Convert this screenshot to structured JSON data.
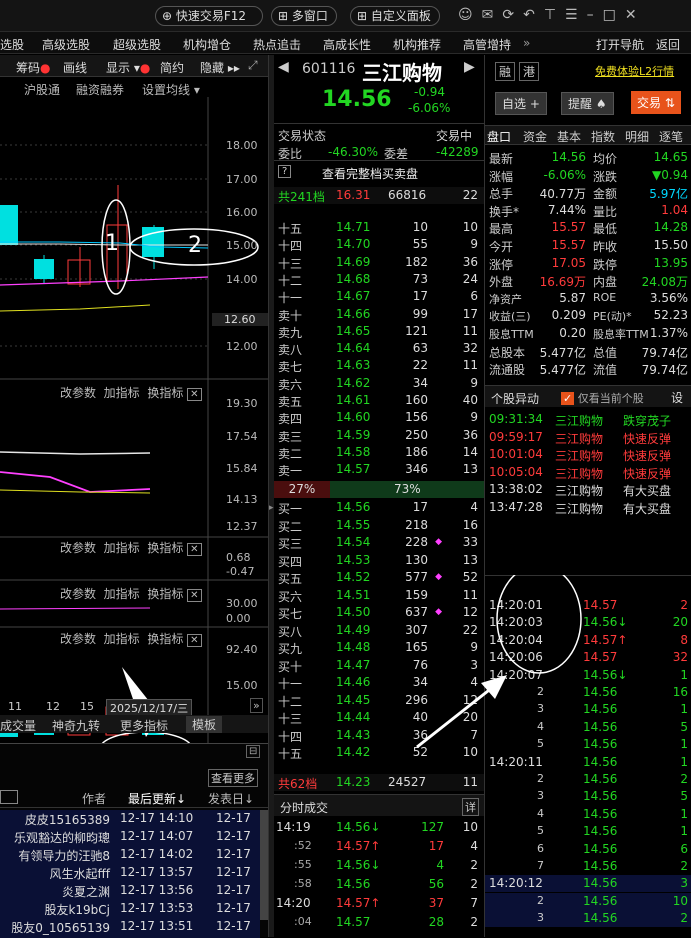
{
  "top": {
    "buttons": [
      "快速交易F12",
      "多窗口",
      "自定义面板"
    ]
  },
  "menu": [
    "选股",
    "高级选股",
    "超级选股",
    "机构增仓",
    "热点追击",
    "高成长性",
    "机构推荐",
    "高管增持",
    "»",
    "打开导航",
    "返回"
  ],
  "toolbar": [
    "筹码",
    "画线",
    "显示",
    "简约",
    "隐藏"
  ],
  "chart": {
    "tabs": [
      "沪股通",
      "融资融券",
      "设置均线"
    ],
    "yticks": [
      "18.00",
      "17.00",
      "16.00",
      "15.00",
      "14.00",
      "12.60",
      "12.00"
    ],
    "sub1": {
      "ops": [
        "改参数",
        "加指标",
        "换指标"
      ],
      "ticks": [
        "19.30",
        "17.54",
        "15.84",
        "14.13",
        "12.37"
      ]
    },
    "sub2": {
      "ops": [
        "改参数",
        "加指标",
        "换指标"
      ],
      "ticks": [
        "0.68",
        "-0.47"
      ]
    },
    "sub3": {
      "ops": [
        "改参数",
        "加指标",
        "换指标"
      ],
      "ticks": [
        "30.00",
        "0.00"
      ]
    },
    "sub4": {
      "ops": [
        "改参数",
        "加指标",
        "换指标"
      ],
      "ticks": [
        "92.40",
        "15.00"
      ]
    },
    "xlabels": [
      "11",
      "12",
      "15"
    ],
    "date": "2025/12/17/三",
    "tabs2": [
      "成交量",
      "神奇九转",
      "更多指标",
      "模板"
    ],
    "anno1": "1",
    "anno2": "2"
  },
  "news": {
    "btn": "查看更多",
    "cols": [
      "作者",
      "最后更新↓",
      "发表日↓"
    ],
    "rows": [
      [
        "皮皮15165389",
        "12-17 14:10",
        "12-17"
      ],
      [
        "乐观豁达的柳昀璁",
        "12-17 14:07",
        "12-17"
      ],
      [
        "有领导力的汪驰8",
        "12-17 14:02",
        "12-17"
      ],
      [
        "风生水起fff",
        "12-17 13:57",
        "12-17"
      ],
      [
        "炎夏之渊",
        "12-17 13:56",
        "12-17"
      ],
      [
        "股友k19bCj",
        "12-17 13:53",
        "12-17"
      ],
      [
        "股友0_10565139",
        "12-17 13:51",
        "12-17"
      ]
    ]
  },
  "stock": {
    "code": "601116",
    "name": "三江购物",
    "price": "14.56",
    "chg": "-0.94",
    "pct": "-6.06%",
    "tags": [
      "融",
      "港"
    ],
    "promo": "免费体验L2行情",
    "buttons": [
      "自选 +",
      "提醒",
      "交易"
    ]
  },
  "ob": {
    "status_label": "交易状态",
    "status": "交易中",
    "wb_label": "委比",
    "wb": "-46.30%",
    "wc_label": "委差",
    "wc": "-42289",
    "link": "查看完整档买卖盘",
    "sell_head": [
      "共241档",
      "16.31",
      "66816",
      "22"
    ],
    "sells": [
      [
        "十五",
        "14.71",
        "10",
        "10"
      ],
      [
        "十四",
        "14.70",
        "55",
        "9"
      ],
      [
        "十三",
        "14.69",
        "182",
        "36"
      ],
      [
        "十二",
        "14.68",
        "73",
        "24"
      ],
      [
        "十一",
        "14.67",
        "17",
        "6"
      ],
      [
        "卖十",
        "14.66",
        "99",
        "17"
      ],
      [
        "卖九",
        "14.65",
        "121",
        "11"
      ],
      [
        "卖八",
        "14.64",
        "63",
        "32"
      ],
      [
        "卖七",
        "14.63",
        "22",
        "11"
      ],
      [
        "卖六",
        "14.62",
        "34",
        "9"
      ],
      [
        "卖五",
        "14.61",
        "160",
        "40"
      ],
      [
        "卖四",
        "14.60",
        "156",
        "9"
      ],
      [
        "卖三",
        "14.59",
        "250",
        "36"
      ],
      [
        "卖二",
        "14.58",
        "186",
        "14"
      ],
      [
        "卖一",
        "14.57",
        "346",
        "13"
      ]
    ],
    "ratio": [
      "27%",
      "73%"
    ],
    "buys": [
      [
        "买一",
        "14.56",
        "17",
        "4"
      ],
      [
        "买二",
        "14.55",
        "218",
        "16"
      ],
      [
        "买三",
        "14.54",
        "228",
        "33"
      ],
      [
        "买四",
        "14.53",
        "130",
        "13"
      ],
      [
        "买五",
        "14.52",
        "577",
        "52"
      ],
      [
        "买六",
        "14.51",
        "159",
        "11"
      ],
      [
        "买七",
        "14.50",
        "637",
        "12"
      ],
      [
        "买八",
        "14.49",
        "307",
        "22"
      ],
      [
        "买九",
        "14.48",
        "165",
        "9"
      ],
      [
        "买十",
        "14.47",
        "76",
        "3"
      ],
      [
        "十一",
        "14.46",
        "34",
        "4"
      ],
      [
        "十二",
        "14.45",
        "296",
        "12"
      ],
      [
        "十三",
        "14.44",
        "40",
        "20"
      ],
      [
        "十四",
        "14.43",
        "36",
        "7"
      ],
      [
        "十五",
        "14.42",
        "52",
        "10"
      ]
    ],
    "buy_foot": [
      "共62档",
      "14.23",
      "24527",
      "11"
    ]
  },
  "ticks": {
    "title": "分时成交",
    "btn": "详",
    "rows": [
      [
        "14:19",
        "14.56↓",
        "127",
        "10",
        "dn"
      ],
      [
        ":52",
        "14.57↑",
        "17",
        "4",
        "up"
      ],
      [
        ":55",
        "14.56↓",
        "4",
        "2",
        "dn"
      ],
      [
        ":58",
        "14.56",
        "56",
        "2",
        "wh"
      ],
      [
        "14:20",
        "14.57↑",
        "37",
        "7",
        "up"
      ],
      [
        ":04",
        "14.57",
        "28",
        "2",
        "wh"
      ]
    ]
  },
  "quote": {
    "tabs": [
      "盘口",
      "资金",
      "基本",
      "指数",
      "明细",
      "逐笔"
    ],
    "rows": [
      [
        "最新",
        "14.56",
        "均价",
        "14.65"
      ],
      [
        "涨幅",
        "-6.06%",
        "涨跌",
        "▼0.94"
      ],
      [
        "总手",
        "40.77万",
        "金额",
        "5.97亿"
      ],
      [
        "换手*",
        "7.44%",
        "量比",
        "1.04"
      ],
      [
        "最高",
        "15.57",
        "最低",
        "14.28"
      ],
      [
        "今开",
        "15.57",
        "昨收",
        "15.50"
      ],
      [
        "涨停",
        "17.05",
        "跌停",
        "13.95"
      ],
      [
        "外盘",
        "16.69万",
        "内盘",
        "24.08万"
      ],
      [
        "净资产",
        "5.87",
        "ROE",
        "3.56%"
      ],
      [
        "收益(三)",
        "0.209",
        "PE(动)*",
        "52.23"
      ],
      [
        "股息TTM",
        "0.20",
        "股息率TTM",
        "1.37%"
      ],
      [
        "总股本",
        "5.477亿",
        "总值",
        "79.74亿"
      ],
      [
        "流通股",
        "5.477亿",
        "流值",
        "79.74亿"
      ]
    ]
  },
  "alerts": {
    "title": "个股异动",
    "check": "仅看当前个股",
    "btn": "设",
    "rows": [
      [
        "09:31:34",
        "三江购物",
        "跌穿茂子"
      ],
      [
        "09:59:17",
        "三江购物",
        "快速反弹"
      ],
      [
        "10:01:04",
        "三江购物",
        "快速反弹"
      ],
      [
        "10:05:04",
        "三江购物",
        "快速反弹"
      ],
      [
        "13:38:02",
        "三江购物",
        "有大买盘"
      ],
      [
        "13:47:28",
        "三江购物",
        "有大买盘"
      ]
    ]
  },
  "detail": [
    [
      "14:20:01",
      "14.57",
      "2",
      "up"
    ],
    [
      "14:20:03",
      "14.56↓",
      "20",
      "dn"
    ],
    [
      "14:20:04",
      "14.57↑",
      "8",
      "up"
    ],
    [
      "14:20:06",
      "14.57",
      "32",
      "up"
    ],
    [
      "14:20:07",
      "14.56↓",
      "1",
      "dn"
    ],
    [
      "2",
      "14.56",
      "16",
      "dn"
    ],
    [
      "3",
      "14.56",
      "1",
      "dn"
    ],
    [
      "4",
      "14.56",
      "5",
      "dn"
    ],
    [
      "5",
      "14.56",
      "1",
      "dn"
    ],
    [
      "14:20:11",
      "14.56",
      "1",
      "dn"
    ],
    [
      "2",
      "14.56",
      "2",
      "dn"
    ],
    [
      "3",
      "14.56",
      "5",
      "dn"
    ],
    [
      "4",
      "14.56",
      "1",
      "dn"
    ],
    [
      "5",
      "14.56",
      "1",
      "dn"
    ],
    [
      "6",
      "14.56",
      "6",
      "dn"
    ],
    [
      "7",
      "14.56",
      "2",
      "dn"
    ],
    [
      "14:20:12",
      "14.56",
      "3",
      "dn"
    ],
    [
      "2",
      "14.56",
      "10",
      "dn"
    ],
    [
      "3",
      "14.56",
      "2",
      "dn"
    ]
  ]
}
